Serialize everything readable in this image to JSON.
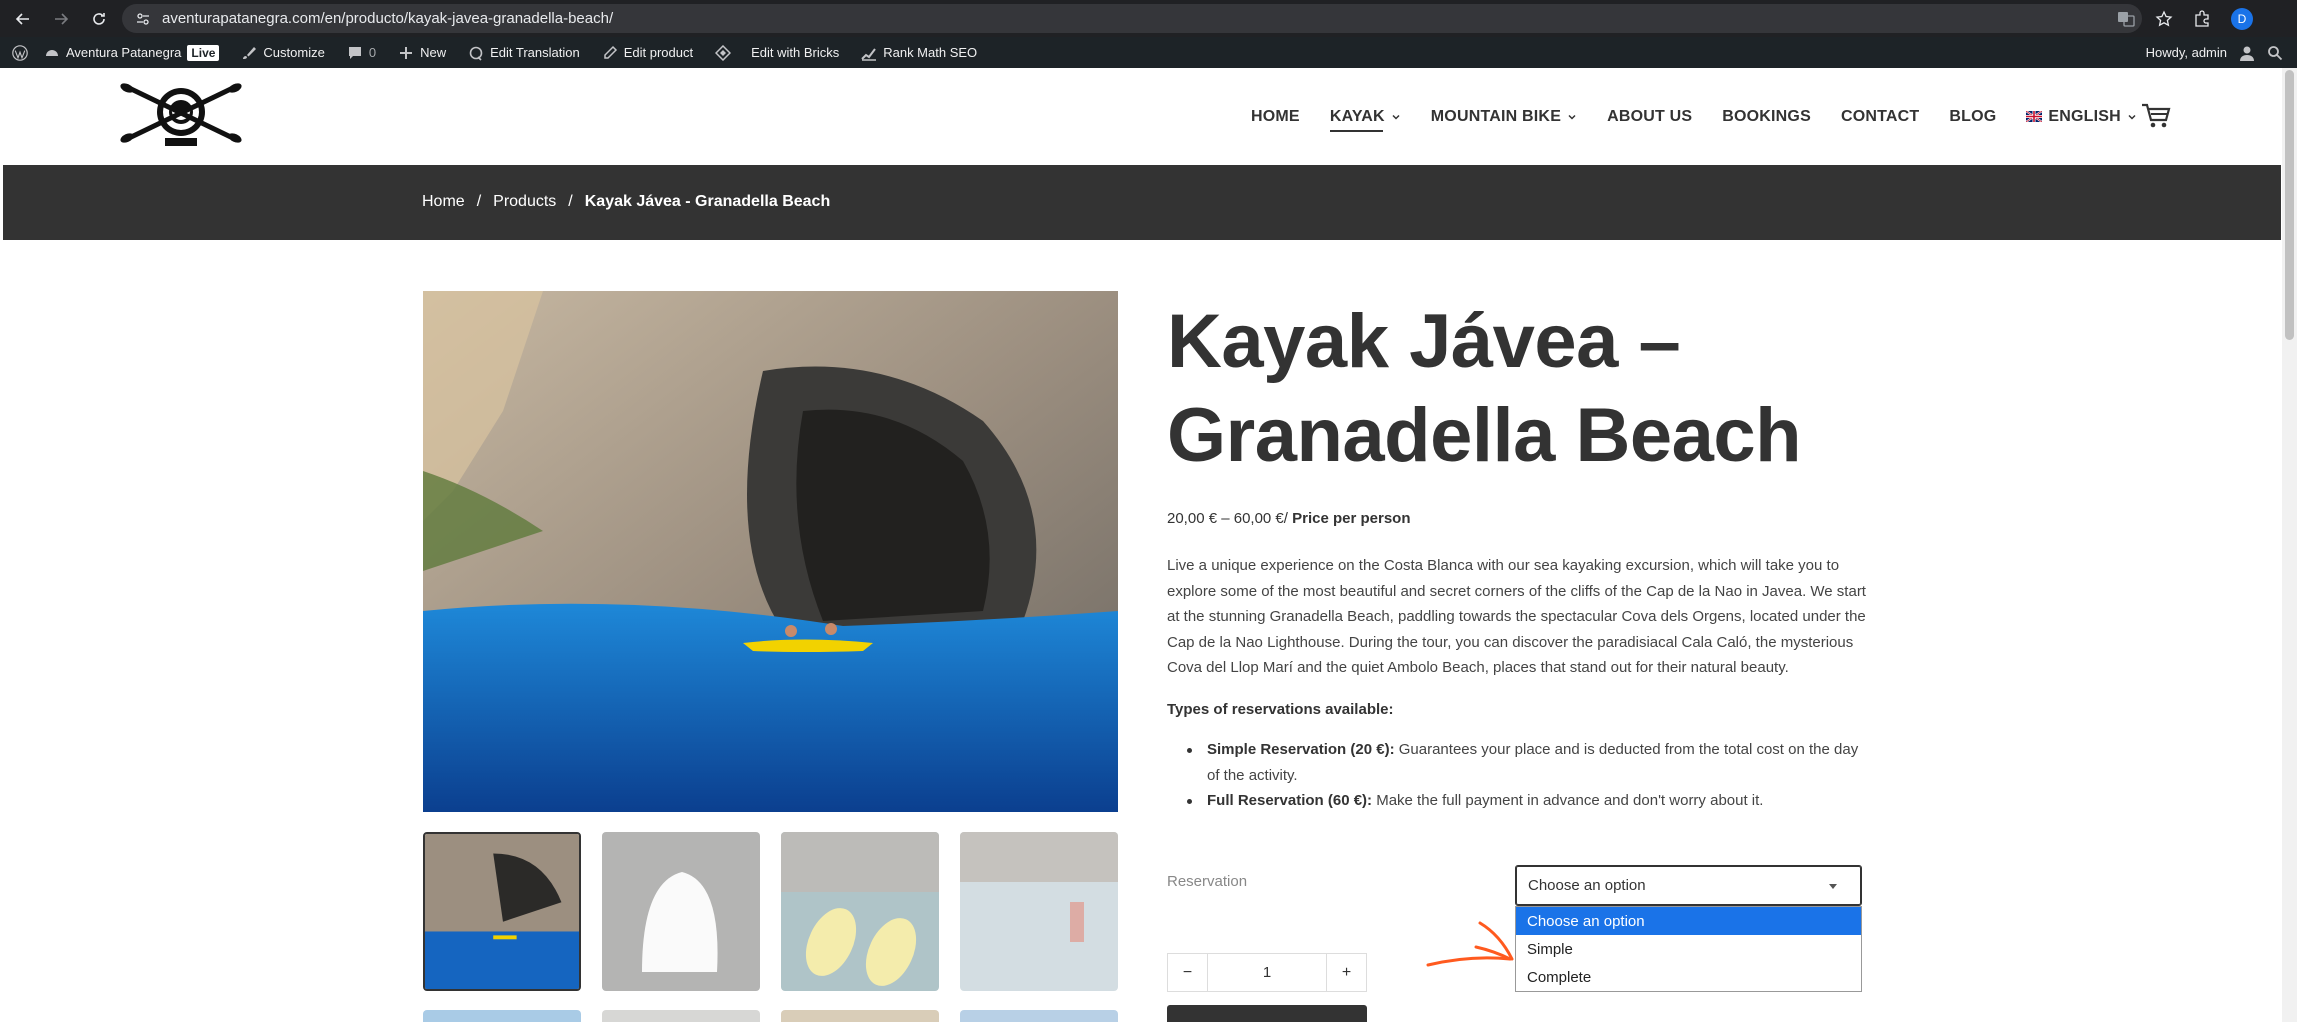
{
  "browser": {
    "url": "aventurapatanegra.com/en/producto/kayak-javea-granadella-beach/",
    "profile_initial": "D"
  },
  "adminbar": {
    "site_name": "Aventura Patanegra",
    "live_badge": "Live",
    "customize": "Customize",
    "comments_count": "0",
    "new": "New",
    "edit_translation": "Edit Translation",
    "edit_product": "Edit product",
    "edit_with_bricks": "Edit with Bricks",
    "rank_math": "Rank Math SEO",
    "howdy": "Howdy, admin"
  },
  "nav": {
    "items": [
      {
        "label": "HOME"
      },
      {
        "label": "KAYAK"
      },
      {
        "label": "MOUNTAIN BIKE"
      },
      {
        "label": "ABOUT US"
      },
      {
        "label": "BOOKINGS"
      },
      {
        "label": "CONTACT"
      },
      {
        "label": "BLOG"
      },
      {
        "label": "ENGLISH"
      }
    ]
  },
  "breadcrumb": {
    "home": "Home",
    "sep": "/",
    "products": "Products",
    "current": "Kayak Jávea - Granadella Beach"
  },
  "product": {
    "title_line1": "Kayak Jávea –",
    "title_line2": "Granadella Beach",
    "price_range": "20,00 € – 60,00 €/",
    "price_suffix": "Price per person",
    "description": "Live a unique experience on the Costa Blanca with our sea kayaking excursion, which will take you to explore some of the most beautiful and secret corners of the cliffs of the Cap de la Nao in Javea. We start at the stunning Granadella Beach, paddling towards the spectacular Cova dels Orgens, located under the Cap de la Nao Lighthouse. During the tour, you can discover the paradisiacal Cala Caló, the mysterious Cova del Llop Marí and the quiet Ambolo Beach, places that stand out for their natural beauty.",
    "types_title": "Types of reservations available:",
    "types": [
      {
        "name": "Simple Reservation (20 €):",
        "text": " Guarantees your place and is deducted from the total cost on the day of the activity."
      },
      {
        "name": "Full Reservation (60 €):",
        "text": " Make the full payment in advance and don't worry about it."
      }
    ]
  },
  "reservation": {
    "label": "Reservation",
    "selected": "Choose an option",
    "options": [
      "Choose an option",
      "Simple",
      "Complete"
    ]
  },
  "quantity": {
    "minus": "−",
    "value": "1",
    "plus": "+"
  },
  "colors": {
    "dark": "#333333",
    "select_highlight": "#1a73e8",
    "annotation": "#ff5a1f"
  }
}
